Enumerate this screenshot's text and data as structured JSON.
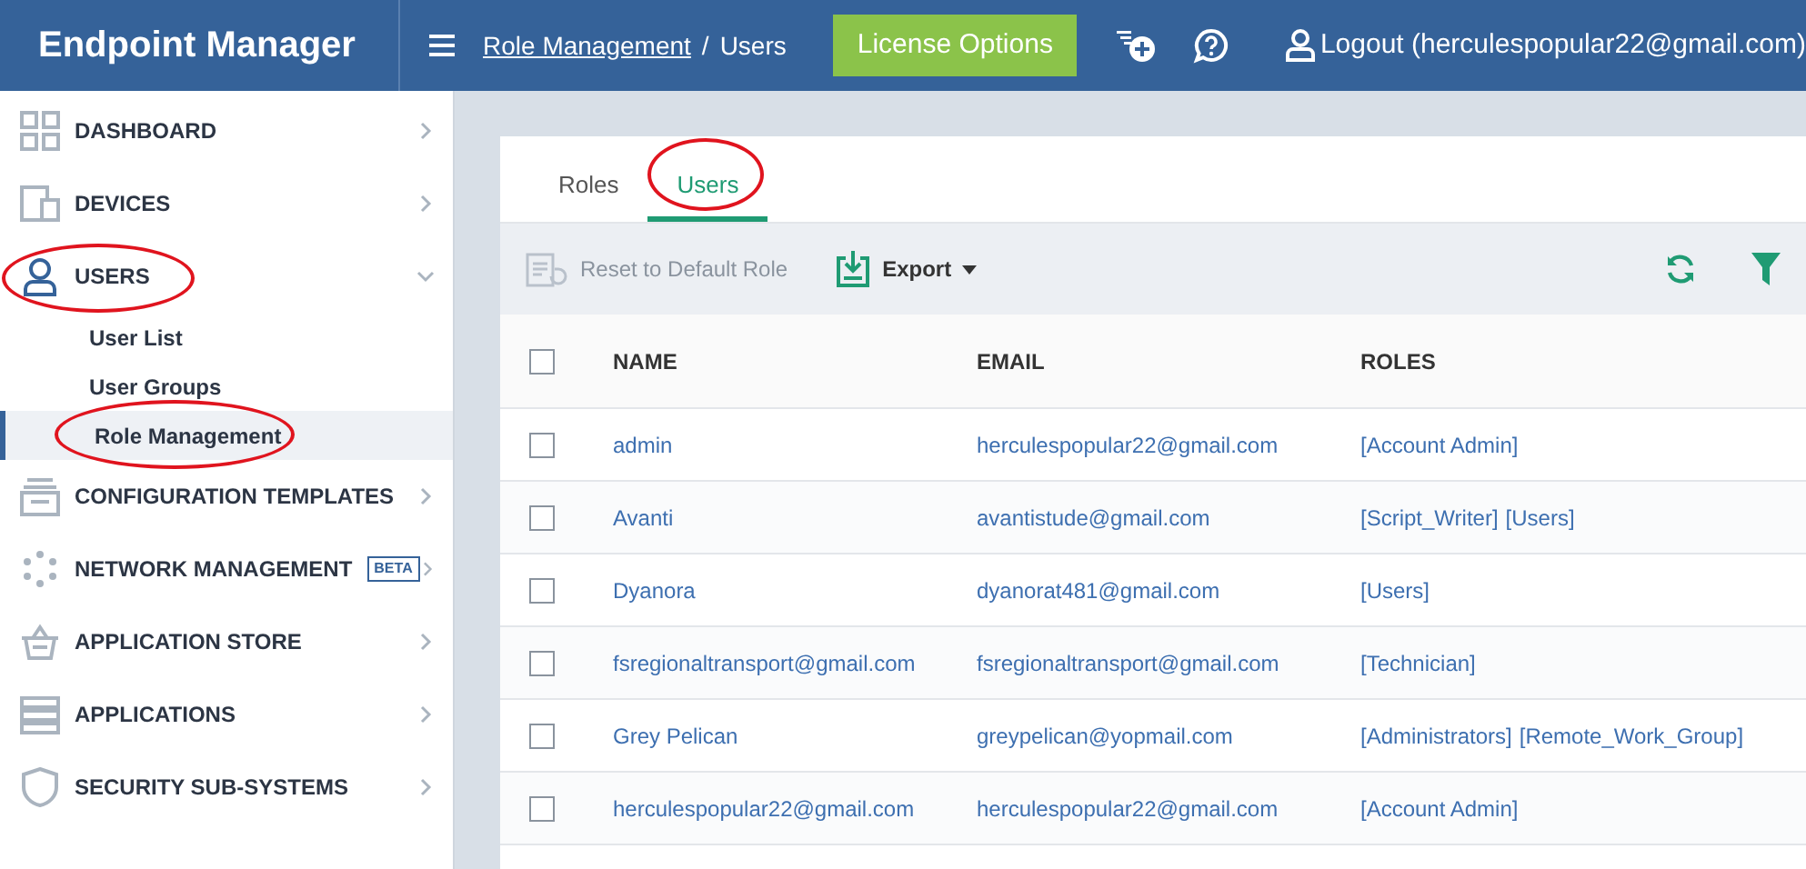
{
  "app_title": "Endpoint Manager",
  "breadcrumb": {
    "link": "Role Management",
    "separator": "/",
    "current": "Users"
  },
  "license_button": "License Options",
  "logout": "Logout (herculespopular22@gmail.com)",
  "sidebar": {
    "items": [
      {
        "label": "DASHBOARD",
        "expanded": false,
        "circled": false
      },
      {
        "label": "DEVICES",
        "expanded": false,
        "circled": false
      },
      {
        "label": "USERS",
        "expanded": true,
        "circled": true,
        "children": [
          {
            "label": "User List",
            "selected": false,
            "circled": false
          },
          {
            "label": "User Groups",
            "selected": false,
            "circled": false
          },
          {
            "label": "Role Management",
            "selected": true,
            "circled": true
          }
        ]
      },
      {
        "label": "CONFIGURATION TEMPLATES",
        "expanded": false,
        "circled": false
      },
      {
        "label": "NETWORK MANAGEMENT",
        "badge": "BETA",
        "expanded": false,
        "circled": false
      },
      {
        "label": "APPLICATION STORE",
        "expanded": false,
        "circled": false
      },
      {
        "label": "APPLICATIONS",
        "expanded": false,
        "circled": false
      },
      {
        "label": "SECURITY SUB-SYSTEMS",
        "expanded": false,
        "circled": false
      }
    ]
  },
  "tabs": [
    {
      "label": "Roles",
      "selected": false,
      "circled": false
    },
    {
      "label": "Users",
      "selected": true,
      "circled": true
    }
  ],
  "toolbar": {
    "reset": {
      "label": "Reset to Default Role",
      "disabled": true
    },
    "export": "Export"
  },
  "table": {
    "select_all_checked": false,
    "columns": [
      "NAME",
      "EMAIL",
      "ROLES"
    ],
    "rows": [
      {
        "name": "admin",
        "email": "herculespopular22@gmail.com",
        "roles": [
          "[Account Admin]"
        ],
        "checked": false
      },
      {
        "name": "Avanti",
        "email": "avantistude@gmail.com",
        "roles": [
          "[Script_Writer]",
          "[Users]"
        ],
        "checked": false
      },
      {
        "name": "Dyanora",
        "email": "dyanorat481@gmail.com",
        "roles": [
          "[Users]"
        ],
        "checked": false
      },
      {
        "name": "fsregionaltransport@gmail.com",
        "email": "fsregionaltransport@gmail.com",
        "roles": [
          "[Technician]"
        ],
        "checked": false
      },
      {
        "name": "Grey Pelican",
        "email": "greypelican@yopmail.com",
        "roles": [
          "[Administrators]",
          "[Remote_Work_Group]"
        ],
        "checked": false
      },
      {
        "name": "herculespopular22@gmail.com",
        "email": "herculespopular22@gmail.com",
        "roles": [
          "[Account Admin]"
        ],
        "checked": false
      }
    ]
  }
}
